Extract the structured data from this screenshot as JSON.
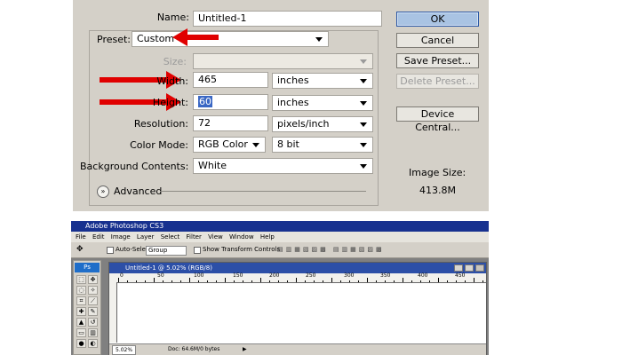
{
  "dialog": {
    "name_label": "Name:",
    "name_value": "Untitled-1",
    "preset_label": "Preset:",
    "preset_value": "Custom",
    "size_label": "Size:",
    "size_value": "",
    "width_label": "Width:",
    "width_value": "465",
    "width_unit": "inches",
    "height_label": "Height:",
    "height_value": "60",
    "height_unit": "inches",
    "resolution_label": "Resolution:",
    "resolution_value": "72",
    "resolution_unit": "pixels/inch",
    "color_mode_label": "Color Mode:",
    "color_mode_value": "RGB Color",
    "bit_depth_value": "8 bit",
    "background_label": "Background Contents:",
    "background_value": "White",
    "advanced_label": "Advanced",
    "image_size_label": "Image Size:",
    "image_size_value": "413.8M",
    "buttons": {
      "ok": "OK",
      "cancel": "Cancel",
      "save_preset": "Save Preset...",
      "delete_preset": "Delete Preset...",
      "device_central": "Device Central..."
    }
  },
  "annotation_color": "#e00000",
  "photoshop": {
    "app_title": "Adobe Photoshop CS3",
    "menus": [
      "File",
      "Edit",
      "Image",
      "Layer",
      "Select",
      "Filter",
      "View",
      "Window",
      "Help"
    ],
    "options": {
      "auto_select_label": "Auto-Select:",
      "auto_select_value": "Group",
      "show_transform_label": "Show Transform Controls"
    },
    "logo": "Ps",
    "document": {
      "title": "Untitled-1 @ 5.02% (RGB/8)",
      "ruler_ticks": [
        "0",
        "50",
        "100",
        "150",
        "200",
        "250",
        "300",
        "350",
        "400",
        "450"
      ],
      "zoom": "5.02%",
      "doc_info": "Doc: 64.6M/0 bytes"
    }
  }
}
